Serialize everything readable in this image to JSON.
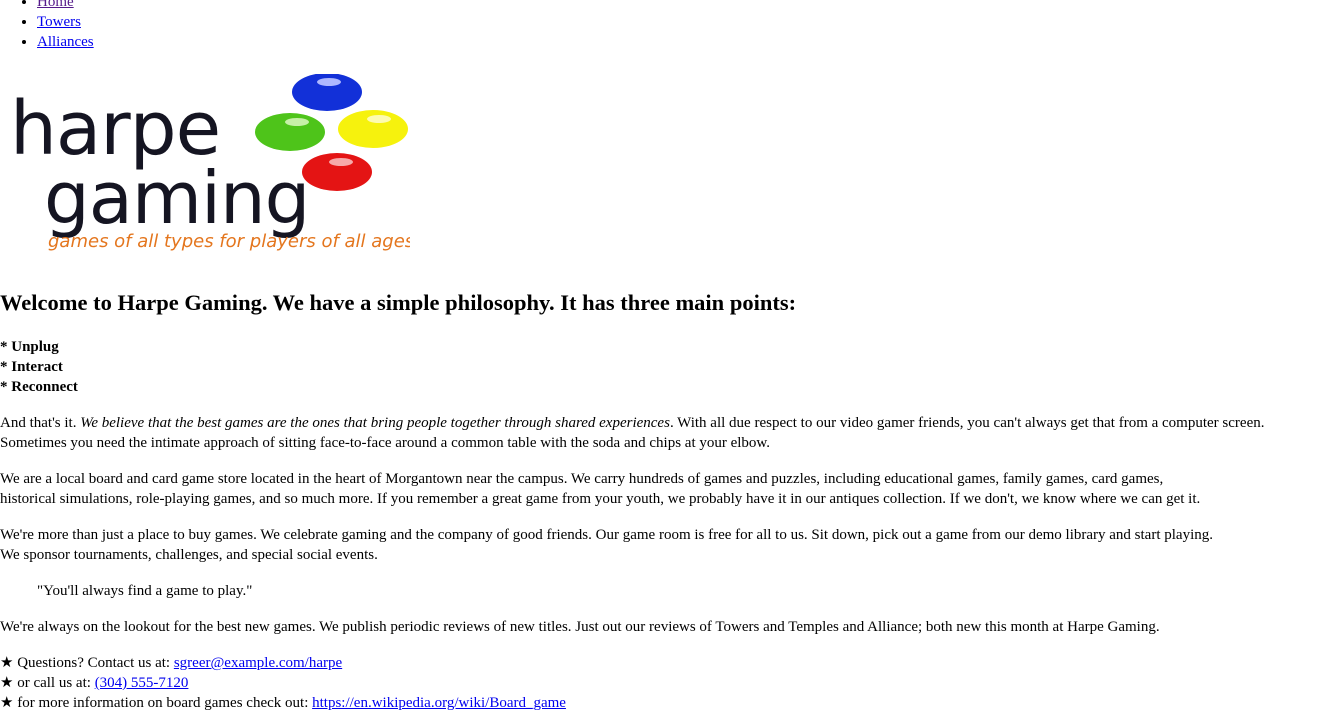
{
  "nav": {
    "items": [
      {
        "label": "Home"
      },
      {
        "label": "Towers"
      },
      {
        "label": "Alliances"
      }
    ]
  },
  "logo": {
    "line1": "harpe",
    "line2": "gaming",
    "tagline": "games of all types for players of all ages",
    "dark_color": "#151522",
    "tagline_color": "#e4761e",
    "ball_colors": [
      "#1230d8",
      "#4ec41a",
      "#f6f20d",
      "#e41414"
    ]
  },
  "heading": "Welcome to Harpe Gaming. We have a simple philosophy. It has three main points:",
  "points": [
    "Unplug",
    "Interact",
    "Reconnect"
  ],
  "bullet_prefix": "* ",
  "para1": {
    "lead": "And that's it. ",
    "emphasis": "We believe that the best games are the ones that bring people together through shared experiences",
    "line1_rest": ". With all due respect to our video gamer friends, you can't always get that from a computer screen.",
    "line2": "Sometimes you need the intimate approach of sitting face-to-face around a common table with the soda and chips at your elbow."
  },
  "para2": {
    "line1": "We are a local board and card game store located in the heart of Morgantown near the campus. We carry hundreds of games and puzzles, including educational games, family games, card games,",
    "line2": "historical simulations, role-playing games, and so much more. If you remember a great game from your youth, we probably have it in our antiques collection. If we don't, we know where we can get it."
  },
  "para3": {
    "line1": "We're more than just a place to buy games. We celebrate gaming and the company of good friends. Our game room is free for all to us. Sit down, pick out a game from our demo library and start playing.",
    "line2": "We sponsor tournaments, challenges, and special social events."
  },
  "quote": "\"You'll always find a game to play.\"",
  "para4": "We're always on the lookout for the best new games. We publish periodic reviews of new titles. Just out our reviews of Towers and Temples and Alliance; both new this month at Harpe Gaming.",
  "contacts": [
    {
      "prefix": "★ Questions? Contact us at: ",
      "link": "sgreer@example.com/harpe"
    },
    {
      "prefix": "★ or call us at: ",
      "link": "(304) 555-7120"
    },
    {
      "prefix": "★ for more information on board games check out: ",
      "link": "https://en.wikipedia.org/wiki/Board_game"
    }
  ]
}
